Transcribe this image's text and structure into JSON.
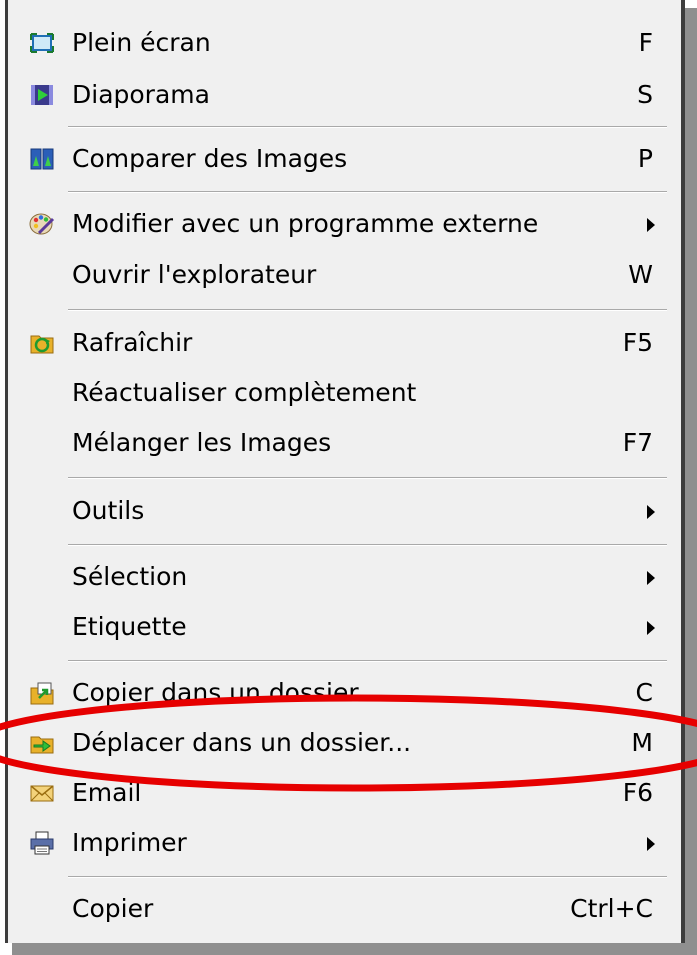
{
  "menu": {
    "items": [
      {
        "label": "Plein écran",
        "shortcut": "F",
        "icon": "fullscreen-icon"
      },
      {
        "label": "Diaporama",
        "shortcut": "S",
        "icon": "slideshow-icon"
      },
      {
        "label": "Comparer des Images",
        "shortcut": "P",
        "icon": "compare-images-icon"
      },
      {
        "label": "Modifier avec un programme externe",
        "shortcut": "",
        "icon": "palette-icon",
        "submenu": true
      },
      {
        "label": "Ouvrir l'explorateur",
        "shortcut": "W"
      },
      {
        "label": "Rafraîchir",
        "shortcut": "F5",
        "icon": "refresh-icon"
      },
      {
        "label": "Réactualiser complètement",
        "shortcut": ""
      },
      {
        "label": "Mélanger les Images",
        "shortcut": "F7"
      },
      {
        "label": "Outils",
        "shortcut": "",
        "submenu": true
      },
      {
        "label": "Sélection",
        "shortcut": "",
        "submenu": true
      },
      {
        "label": "Etiquette",
        "shortcut": "",
        "submenu": true
      },
      {
        "label": "Copier dans un dossier...",
        "shortcut": "C",
        "icon": "copy-to-folder-icon"
      },
      {
        "label": "Déplacer dans un dossier...",
        "shortcut": "M",
        "icon": "move-to-folder-icon"
      },
      {
        "label": "Email",
        "shortcut": "F6",
        "icon": "email-icon"
      },
      {
        "label": "Imprimer",
        "shortcut": "",
        "icon": "printer-icon",
        "submenu": true
      },
      {
        "label": "Copier",
        "shortcut": "Ctrl+C"
      }
    ]
  },
  "colors": {
    "menu_background": "#f0f0f0",
    "separator": "#a9a9a9",
    "highlight_annotation": "#e60000"
  }
}
